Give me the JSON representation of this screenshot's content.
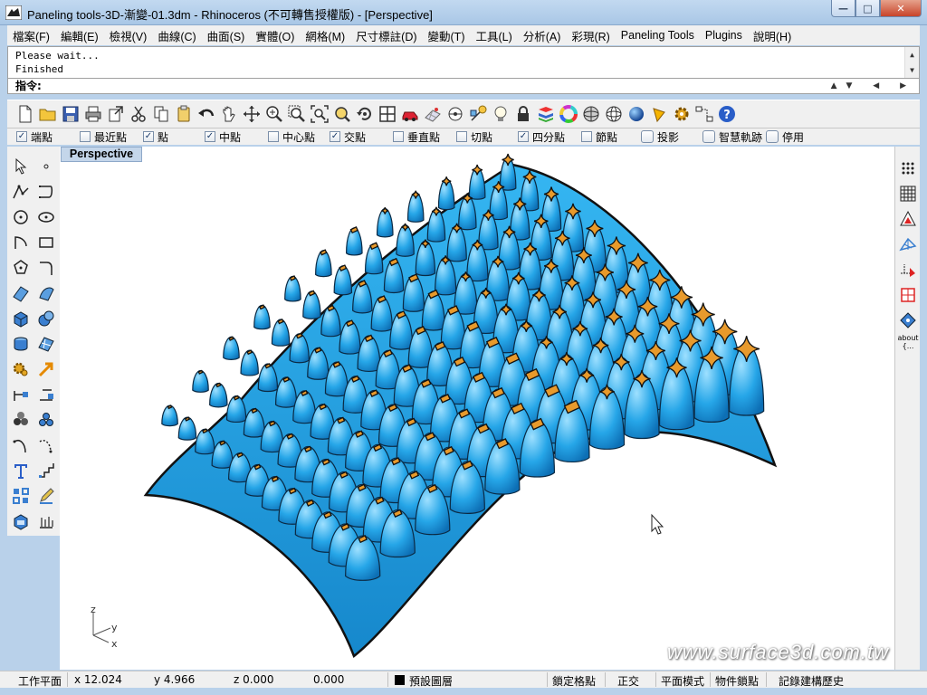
{
  "window": {
    "title": "Paneling tools-3D-漸變-01.3dm - Rhinoceros (不可轉售授權版) - [Perspective]",
    "minimize": "—",
    "maximize": "□",
    "close": "✕"
  },
  "menu": [
    "檔案(F)",
    "編輯(E)",
    "檢視(V)",
    "曲線(C)",
    "曲面(S)",
    "實體(O)",
    "網格(M)",
    "尺寸標註(D)",
    "變動(T)",
    "工具(L)",
    "分析(A)",
    "彩現(R)",
    "Paneling Tools",
    "Plugins",
    "說明(H)"
  ],
  "command": {
    "history": [
      "Please wait...",
      "Finished"
    ],
    "prompt": "指令:",
    "scroll_up": "▲",
    "scroll_down": "▼",
    "arrows": "▲▼ ◀ ▶"
  },
  "toolbar_icons": [
    "new-file",
    "open-folder",
    "save-disk",
    "print",
    "export",
    "cut-scissors",
    "copy",
    "paste",
    "undo",
    "pan-hand",
    "rotate-view",
    "zoom-dynamic",
    "zoom-window",
    "zoom-extents",
    "zoom-selected",
    "rotate-camera",
    "four-viewports",
    "car-render",
    "grid-plane",
    "cplane",
    "named-views",
    "light-bulb",
    "lock",
    "layer",
    "color-wheel",
    "shaded-sphere",
    "wireframe-sphere",
    "render-sphere",
    "sun",
    "gear-options",
    "flowchart",
    "help"
  ],
  "osnaps": [
    {
      "label": "端點",
      "checked": true
    },
    {
      "label": "最近點",
      "checked": false
    },
    {
      "label": "點",
      "checked": true
    },
    {
      "label": "中點",
      "checked": true
    },
    {
      "label": "中心點",
      "checked": false
    },
    {
      "label": "交點",
      "checked": true
    },
    {
      "label": "垂直點",
      "checked": false
    },
    {
      "label": "切點",
      "checked": false
    },
    {
      "label": "四分點",
      "checked": true
    },
    {
      "label": "節點",
      "checked": false
    },
    {
      "label": "投影",
      "checked": false
    },
    {
      "label": "智慧軌跡",
      "checked": false
    },
    {
      "label": "停用",
      "checked": false
    }
  ],
  "viewport": {
    "label": "Perspective",
    "axis_z": "z",
    "axis_y": "y",
    "axis_x": "x",
    "watermark": "www.surface3d.com.tw"
  },
  "right_tools": {
    "about_label": "about {..."
  },
  "status": {
    "cplane": "工作平面",
    "x": "x 12.024",
    "y": "y 4.966",
    "z": "z 0.000",
    "extra": "0.000",
    "layer": "預設圖層",
    "grid_snap": "鎖定格點",
    "ortho": "正交",
    "planar": "平面模式",
    "osnap": "物件鎖點",
    "history": "記錄建構歷史"
  },
  "colors": {
    "surface_blue": "#1f9bdc",
    "panel_orange": "#e89a2c",
    "viewport_tab": "#c4d6ea",
    "frame": "#b9d1ea"
  }
}
